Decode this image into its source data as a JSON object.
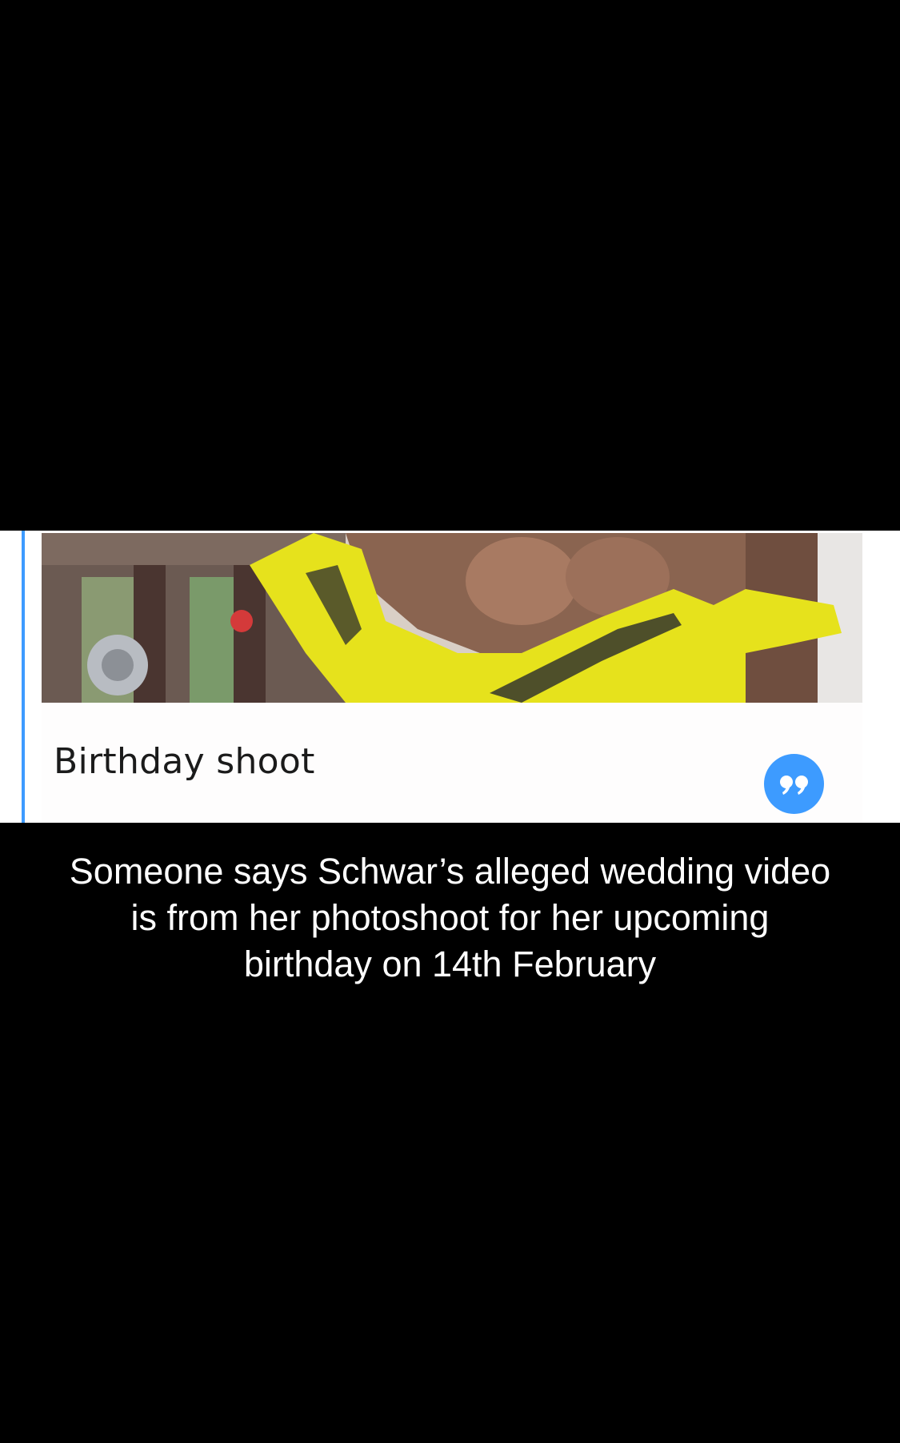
{
  "story_card": {
    "title": "Birthday shoot",
    "quote_icon": "quote-icon",
    "accent_color": "#3d9bff"
  },
  "caption": {
    "lines": [
      "Someone says Schwar’s alleged wedding video",
      "is from her photoshoot for her upcoming",
      "birthday on 14th February"
    ]
  },
  "colors": {
    "background": "#000000",
    "card": "#ffffff",
    "caption_text": "#ffffff",
    "dress": "#e6e21c"
  }
}
